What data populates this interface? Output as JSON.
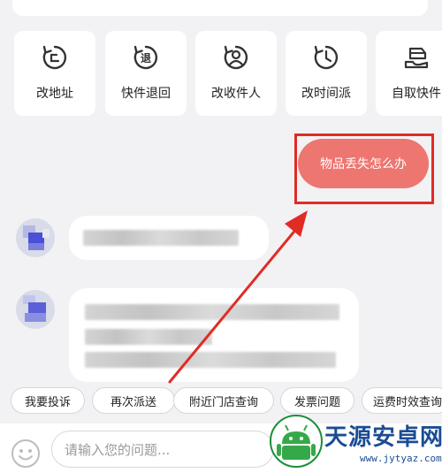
{
  "quick_actions": [
    {
      "label": "改地址",
      "icon": "change-address-icon"
    },
    {
      "label": "快件退回",
      "icon": "return-parcel-icon"
    },
    {
      "label": "改收件人",
      "icon": "change-recipient-icon"
    },
    {
      "label": "改时间派",
      "icon": "reschedule-icon"
    },
    {
      "label": "自取快件",
      "icon": "self-pickup-icon"
    }
  ],
  "chat": {
    "user_message": "物品丢失怎么办"
  },
  "quick_replies": [
    "我要投诉",
    "再次派送",
    "附近门店查询",
    "发票问题",
    "运费时效查询"
  ],
  "composer": {
    "placeholder": "请输入您的问题..."
  },
  "watermark": {
    "title": "天源安卓网",
    "url": "www.jytyaz.com"
  },
  "colors": {
    "accent": "#ee7670",
    "highlight": "#e02c25",
    "watermark": "#1b4c93"
  }
}
